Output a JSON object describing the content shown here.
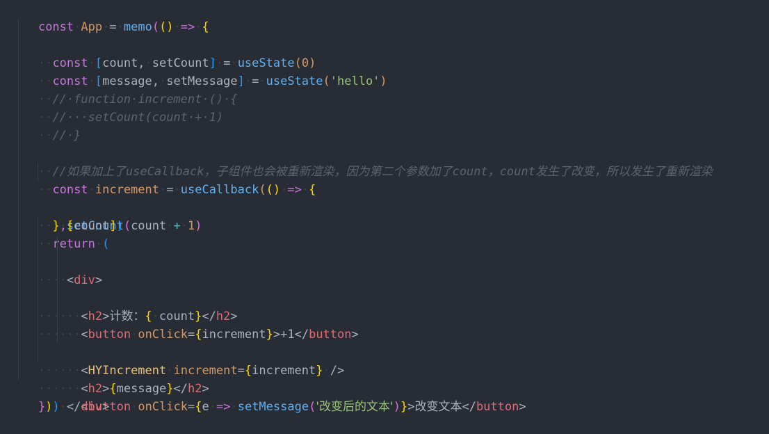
{
  "editor": {
    "background": "#282c34",
    "font_size_px": 17,
    "line_height_px": 26,
    "whitespace_dot": "·",
    "language": "javascript-react-jsx",
    "colors": {
      "keyword": "#c678dd",
      "function": "#61afef",
      "variable": "#d19a66",
      "string": "#98c379",
      "comment": "#5c6370",
      "tag": "#e06c75",
      "component": "#e5c07b",
      "plain": "#abb2bf",
      "bracket_yellow": "#ffd700",
      "bracket_magenta": "#da70d6",
      "bracket_blue": "#179fff",
      "operator_cyan": "#56b6c2",
      "indent_guide": "#3b4049",
      "background": "#282c34"
    },
    "lines": [
      {
        "n": 1,
        "indent": 0,
        "text": "const App = memo(() => {"
      },
      {
        "n": 2,
        "indent": 1,
        "text": "  const [count, setCount] = useState(0)"
      },
      {
        "n": 3,
        "indent": 1,
        "text": "  const [message, setMessage] = useState('hello')"
      },
      {
        "n": 4,
        "indent": 1,
        "text": "  // function increment () {"
      },
      {
        "n": 5,
        "indent": 1,
        "text": "  //   setCount(count + 1)"
      },
      {
        "n": 6,
        "indent": 1,
        "text": "  // }"
      },
      {
        "n": 7,
        "indent": 0,
        "text": ""
      },
      {
        "n": 8,
        "indent": 1,
        "text": "  //如果加上了useCallback，子组件也会被重新渲染，因为第二个参数加了count，count发生了改变，所以发生了重新渲染"
      },
      {
        "n": 9,
        "indent": 1,
        "text": "  const increment = useCallback(() => {"
      },
      {
        "n": 10,
        "indent": 2,
        "text": "    setCount(count + 1)"
      },
      {
        "n": 11,
        "indent": 1,
        "text": "  },[count])"
      },
      {
        "n": 12,
        "indent": 1,
        "text": "  return ("
      },
      {
        "n": 13,
        "indent": 2,
        "text": "    <div>"
      },
      {
        "n": 14,
        "indent": 3,
        "text": "      <h2>计数：{ count}</h2>"
      },
      {
        "n": 15,
        "indent": 3,
        "text": "      <button onClick={increment}>+1</button>"
      },
      {
        "n": 16,
        "indent": 0,
        "text": ""
      },
      {
        "n": 17,
        "indent": 3,
        "text": "      <HYIncrement increment={increment} />"
      },
      {
        "n": 18,
        "indent": 3,
        "text": "      <h2>{message}</h2>"
      },
      {
        "n": 19,
        "indent": 3,
        "text": "      <button onClick={e => setMessage('改变后的文本')}>改变文本</button>"
      },
      {
        "n": 20,
        "indent": 2,
        "text": "    </div>"
      },
      {
        "n": 21,
        "indent": 1,
        "text": "  )"
      },
      {
        "n": 22,
        "indent": 0,
        "text": "})"
      }
    ],
    "comment_chinese_line8": "//如果加上了useCallback，子组件也会被重新渲染，因为第二个参数加了count，count发生了改变，所以发生了重新渲染",
    "jsx_text_counter_label": "计数：",
    "jsx_button_plus_one": "+1",
    "jsx_button_change_text": "改变文本",
    "string_changed_text": "改变后的文本",
    "string_hello": "hello"
  }
}
